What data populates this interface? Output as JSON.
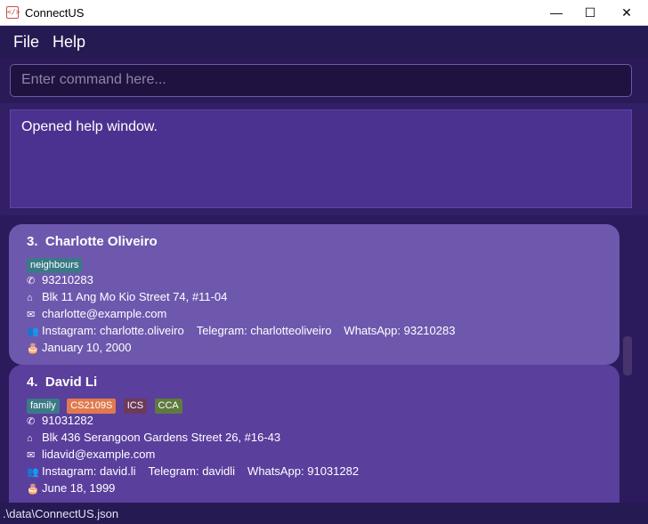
{
  "window": {
    "title": "ConnectUS",
    "app_icon": "</>",
    "controls": {
      "minimize": "—",
      "maximize": "☐",
      "close": "✕"
    }
  },
  "menu": {
    "file": "File",
    "help": "Help"
  },
  "command": {
    "placeholder": "Enter command here..."
  },
  "result": {
    "text": "Opened help window."
  },
  "persons": [
    {
      "index": "3.",
      "name": "Charlotte Oliveiro",
      "tags": [
        {
          "label": "neighbours",
          "color": "#3a7a86"
        }
      ],
      "phone": "93210283",
      "address": "Blk 11 Ang Mo Kio Street 74, #11-04",
      "email": "charlotte@example.com",
      "instagram": "Instagram: charlotte.oliveiro",
      "telegram": "Telegram: charlotteoliveiro",
      "whatsapp": "WhatsApp: 93210283",
      "birthday": "January 10, 2000"
    },
    {
      "index": "4.",
      "name": "David Li",
      "tags": [
        {
          "label": "family",
          "color": "#3a7a86"
        },
        {
          "label": "CS2109S",
          "color": "#e07a4e"
        },
        {
          "label": "ICS",
          "color": "#6b3b5a"
        },
        {
          "label": "CCA",
          "color": "#5f7a3e"
        }
      ],
      "phone": "91031282",
      "address": "Blk 436 Serangoon Gardens Street 26, #16-43",
      "email": "lidavid@example.com",
      "instagram": "Instagram: david.li",
      "telegram": "Telegram: davidli",
      "whatsapp": "WhatsApp: 91031282",
      "birthday": "June 18, 1999"
    }
  ],
  "status": {
    "path": ".\\data\\ConnectUS.json"
  },
  "icons": {
    "phone": "phone-icon",
    "address": "home-icon",
    "email": "mail-icon",
    "social": "people-icon",
    "birthday": "cake-icon"
  }
}
